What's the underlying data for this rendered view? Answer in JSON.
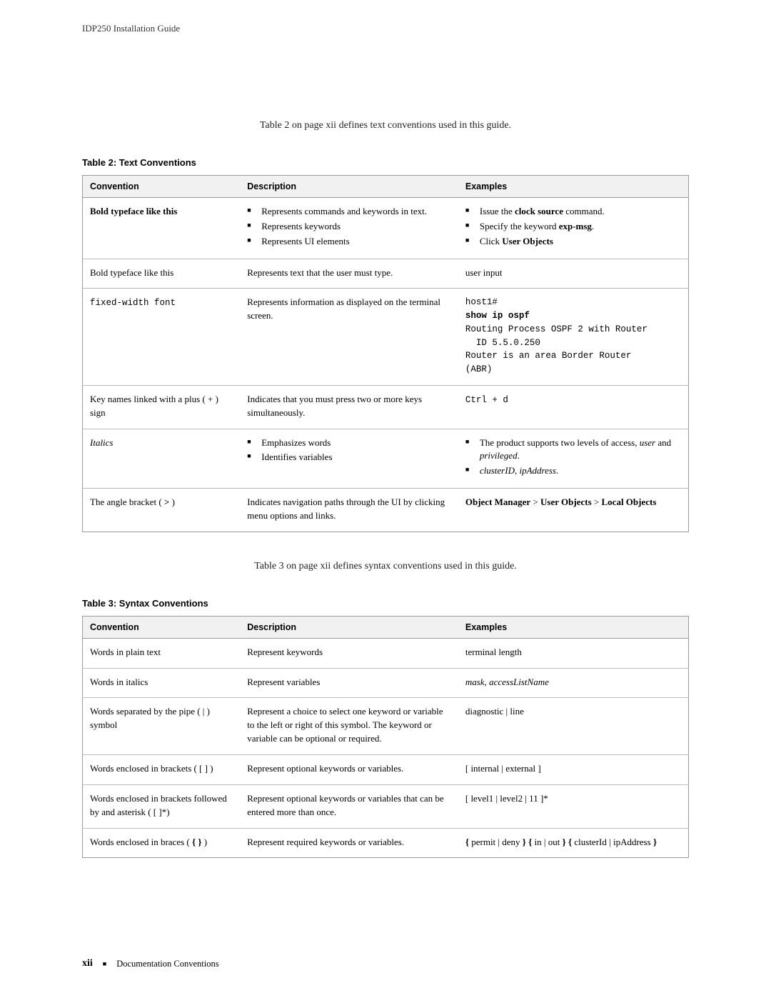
{
  "header": {
    "title": "IDP250 Installation Guide"
  },
  "intro1": "Table 2 on page xii defines text conventions used in this guide.",
  "table2": {
    "caption": "Table 2: Text Conventions",
    "headers": {
      "c1": "Convention",
      "c2": "Description",
      "c3": "Examples"
    },
    "rows": {
      "r1": {
        "conv_bold": "Bold typeface like this",
        "desc_b1": "Represents commands and keywords in text.",
        "desc_b2": "Represents keywords",
        "desc_b3": "Represents UI elements",
        "ex_b1a": "Issue the ",
        "ex_b1b": "clock source",
        "ex_b1c": " command.",
        "ex_b2a": "Specify the keyword ",
        "ex_b2b": "exp-msg",
        "ex_b2c": ".",
        "ex_b3a": "Click ",
        "ex_b3b": "User Objects"
      },
      "r2": {
        "conv": "Bold typeface like this",
        "desc": "Represents text that the user must type.",
        "ex": "user input"
      },
      "r3": {
        "conv": "fixed-width font",
        "desc": "Represents information as displayed on the terminal screen.",
        "ex_l1": "host1#",
        "ex_l2": "show ip ospf",
        "ex_l3": "Routing Process OSPF 2 with Router",
        "ex_l4": "  ID 5.5.0.250",
        "ex_l5": "Router is an area Border Router",
        "ex_l6": "(ABR)"
      },
      "r4": {
        "conv": "Key names linked with a plus ( + ) sign",
        "desc": "Indicates that you must press two or more keys simultaneously.",
        "ex": "Ctrl + d"
      },
      "r5": {
        "conv": "Italics",
        "desc_b1": "Emphasizes words",
        "desc_b2": "Identifies variables",
        "ex_b1a": "The product supports two levels of access, ",
        "ex_b1b": "user",
        "ex_b1c": " and ",
        "ex_b1d": "privileged",
        "ex_b1e": ".",
        "ex_b2a": "clusterID",
        "ex_b2b": ", ",
        "ex_b2c": "ipAddress",
        "ex_b2d": "."
      },
      "r6": {
        "conv_a": "The angle bracket ( ",
        "conv_b": ">",
        "conv_c": " )",
        "desc": "Indicates navigation paths through the UI by clicking menu options and links.",
        "ex_a": "Object Manager",
        "ex_b": " > ",
        "ex_c": "User Objects",
        "ex_d": " > ",
        "ex_e": "Local Objects"
      }
    }
  },
  "intro2": "Table 3 on page xii defines syntax conventions used in this guide.",
  "table3": {
    "caption": "Table 3: Syntax Conventions",
    "headers": {
      "c1": "Convention",
      "c2": "Description",
      "c3": "Examples"
    },
    "rows": {
      "r1": {
        "conv": "Words in plain text",
        "desc": "Represent keywords",
        "ex": "terminal length"
      },
      "r2": {
        "conv": "Words in italics",
        "desc": "Represent variables",
        "ex_a": "mask",
        "ex_b": ", ",
        "ex_c": "accessListName"
      },
      "r3": {
        "conv": "Words separated by the pipe ( | ) symbol",
        "desc": "Represent a choice to select one keyword or variable to the left or right of this symbol. The keyword or variable can be optional or required.",
        "ex": "diagnostic | line"
      },
      "r4": {
        "conv": "Words enclosed in brackets ( [ ] )",
        "desc": "Represent optional keywords or variables.",
        "ex": "[ internal | external ]"
      },
      "r5": {
        "conv": "Words enclosed in brackets followed by and asterisk ( [ ]*)",
        "desc": "Represent optional keywords or variables that can be entered more than once.",
        "ex": "[ level1 | level2 | 11 ]*"
      },
      "r6": {
        "conv_a": "Words enclosed in braces ( ",
        "conv_b": "{ }",
        "conv_c": " )",
        "desc": "Represent required keywords or variables.",
        "ex_a": "{",
        "ex_b": " permit | deny ",
        "ex_c": "}",
        "ex_d": " ",
        "ex_e": "{",
        "ex_f": " in | out ",
        "ex_g": "}",
        "ex_h": " ",
        "ex_i": "{",
        "ex_j": " clusterId | ipAddress ",
        "ex_k": "}"
      }
    }
  },
  "footer": {
    "page": "xii",
    "section": "Documentation Conventions"
  }
}
